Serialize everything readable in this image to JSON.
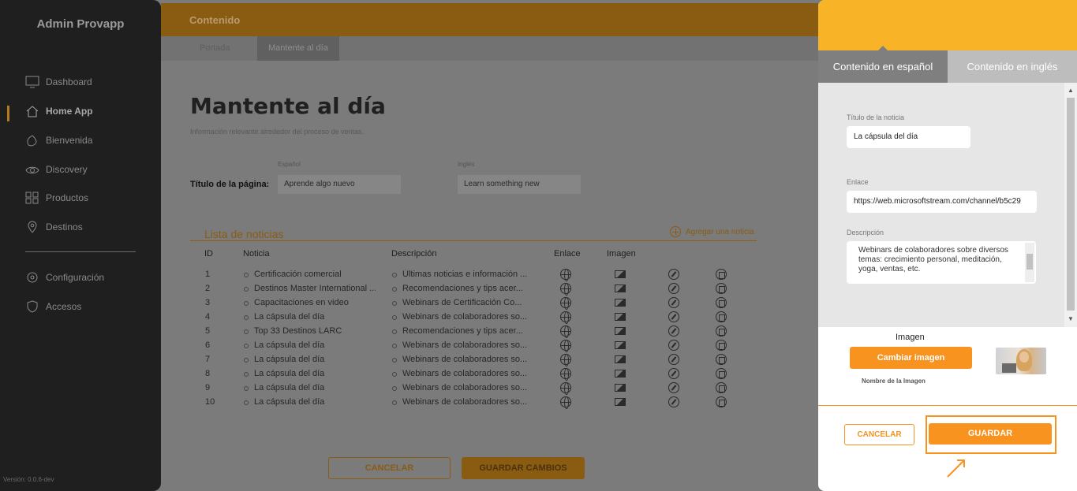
{
  "sidebar": {
    "brand": "Admin Provapp",
    "items": [
      {
        "label": "Dashboard",
        "icon": "monitor-icon"
      },
      {
        "label": "Home App",
        "icon": "home-icon",
        "active": true
      },
      {
        "label": "Bienvenida",
        "icon": "hand-icon"
      },
      {
        "label": "Discovery",
        "icon": "eye-icon"
      },
      {
        "label": "Productos",
        "icon": "grid-icon"
      },
      {
        "label": "Destinos",
        "icon": "location-pin-icon"
      }
    ],
    "settings": [
      {
        "label": "Configuración",
        "icon": "gear-icon"
      },
      {
        "label": "Accesos",
        "icon": "shield-icon"
      }
    ],
    "version": "Versión: 0.0.6-dev"
  },
  "main": {
    "section_title": "Contenido",
    "tabs": [
      {
        "label": "Portada"
      },
      {
        "label": "Mantente al día",
        "active": true
      }
    ],
    "page_title": "Mantente al día",
    "page_subtitle": "Información relevante alrededor del proceso de ventas.",
    "title_field": {
      "label": "Título de la página:",
      "es_label": "Español",
      "es_value": "Aprende algo nuevo",
      "en_label": "Inglés",
      "en_value": "Learn something new"
    },
    "list_title": "Lista de noticias",
    "add_news": "Agregar una noticia",
    "columns": [
      "ID",
      "Noticia",
      "Descripción",
      "Enlace",
      "Imagen"
    ],
    "rows": [
      {
        "id": "1",
        "news": "Certificación comercial",
        "desc": "Últimas noticias e información ..."
      },
      {
        "id": "2",
        "news": "Destinos Master International ...",
        "desc": "Recomendaciones y tips acer..."
      },
      {
        "id": "3",
        "news": "Capacitaciones en video",
        "desc": "Webinars de Certificación Co..."
      },
      {
        "id": "4",
        "news": "La cápsula del día",
        "desc": "Webinars de colaboradores so..."
      },
      {
        "id": "5",
        "news": "Top 33 Destinos LARC",
        "desc": "Recomendaciones y tips acer..."
      },
      {
        "id": "6",
        "news": "La cápsula del día",
        "desc": "Webinars de colaboradores so..."
      },
      {
        "id": "7",
        "news": "La cápsula del día",
        "desc": "Webinars de colaboradores so..."
      },
      {
        "id": "8",
        "news": "La cápsula del día",
        "desc": "Webinars de colaboradores so..."
      },
      {
        "id": "9",
        "news": "La cápsula del día",
        "desc": "Webinars de colaboradores so..."
      },
      {
        "id": "10",
        "news": "La cápsula del día",
        "desc": "Webinars de colaboradores so..."
      }
    ],
    "cancel_label": "CANCELAR",
    "save_label": "GUARDAR CAMBIOS"
  },
  "panel": {
    "tabs": [
      {
        "label": "Contenido en español",
        "active": true
      },
      {
        "label": "Contenido en inglés"
      }
    ],
    "news_title_label": "Título de la noticia",
    "news_title_value": "La cápsula del día",
    "link_label": "Enlace",
    "link_value": "https://web.microsoftstream.com/channel/b5c29",
    "description_label": "Descripción",
    "description_value": "Webinars de colaboradores sobre diversos temas: crecimiento personal, meditación, yoga, ventas, etc.",
    "image_label": "Imagen",
    "change_image": "Cambiar imagen",
    "image_name": "Nombre de la Imagen",
    "cancel_label": "CANCELAR",
    "save_label": "GUARDAR"
  },
  "colors": {
    "accent": "#f7931e",
    "header": "#f8b426",
    "sidebar": "#1f1f1f"
  }
}
